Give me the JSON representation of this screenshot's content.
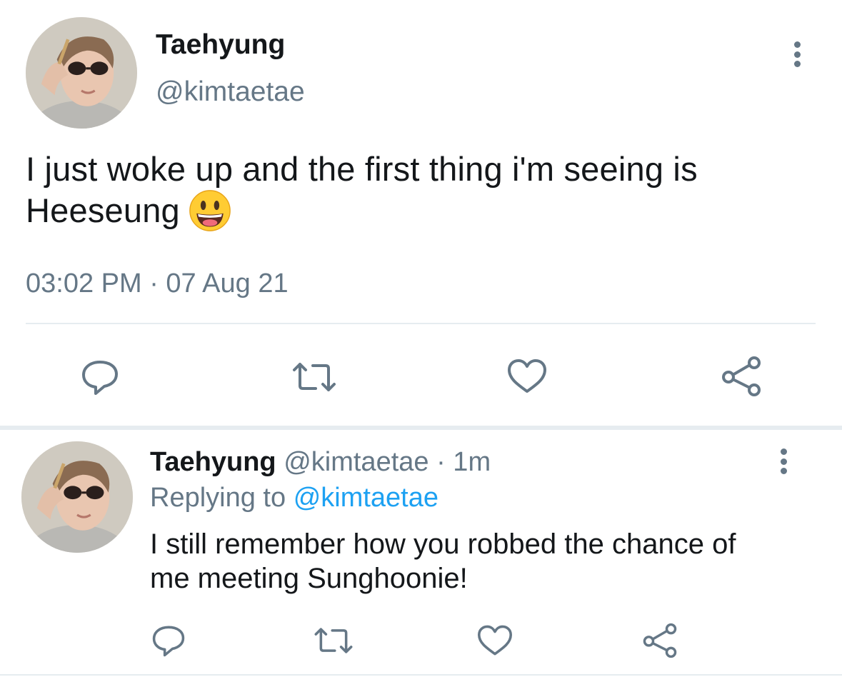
{
  "tweet": {
    "author_name": "Taehyung",
    "author_handle": "@kimtaetae",
    "text": "I just woke up and the first thing i'm seeing is Heeseung",
    "emoji": "😃",
    "timestamp": "03:02 PM · 07 Aug 21",
    "actions": [
      "reply-icon",
      "retweet-icon",
      "like-icon",
      "share-icon"
    ]
  },
  "reply": {
    "author_name": "Taehyung",
    "author_handle": "@kimtaetae",
    "time_ago": "· 1m",
    "replying_prefix": "Replying to",
    "replying_handle": "@kimtaetae",
    "text_line1": "I still remember how you robbed the chance of",
    "text_line2": "me meeting Sunghoonie!",
    "actions": [
      "reply-icon",
      "retweet-icon",
      "like-icon",
      "share-icon"
    ]
  },
  "colors": {
    "text": "#14171a",
    "secondary": "#657786",
    "link": "#1da1f2",
    "divider": "#e6ecf0"
  }
}
